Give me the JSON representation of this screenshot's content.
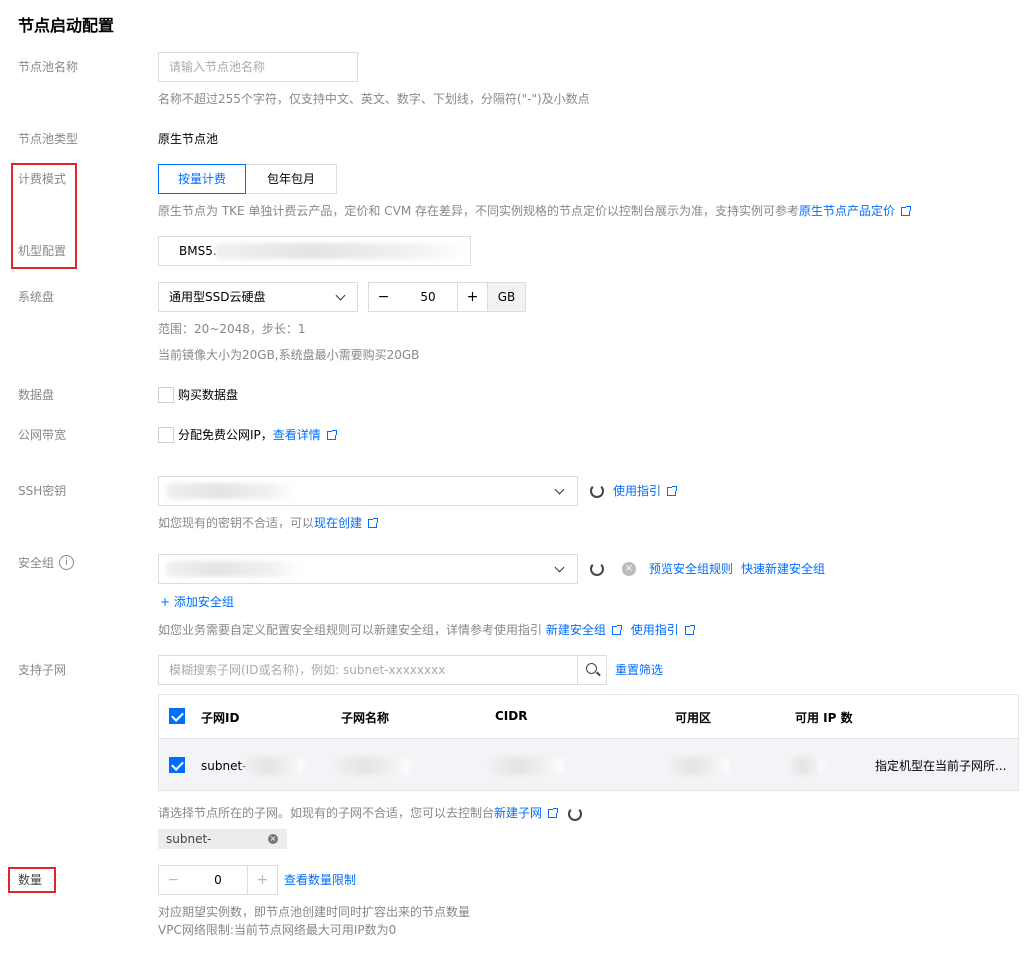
{
  "page": {
    "title": "节点启动配置"
  },
  "colors": {
    "link": "#006eff",
    "highlight": "#e0242b",
    "checkbox": "#006eff"
  },
  "pool_name": {
    "label": "节点池名称",
    "placeholder": "请输入节点池名称",
    "hint": "名称不超过255个字符，仅支持中文、英文、数字、下划线，分隔符(\"-\")及小数点"
  },
  "pool_type": {
    "label": "节点池类型",
    "value": "原生节点池"
  },
  "billing": {
    "label": "计费模式",
    "options": [
      "按量计费",
      "包年包月"
    ],
    "selected": "按量计费",
    "hint": "原生节点为 TKE 单独计费云产品，定价和 CVM 存在差异，不同实例规格的节点定价以控制台展示为准，支持实例可参考",
    "hint_link": "原生节点产品定价"
  },
  "model": {
    "label": "机型配置",
    "value": "BMS5."
  },
  "system_disk": {
    "label": "系统盘",
    "type": "通用型SSD云硬盘",
    "size": "50",
    "unit": "GB",
    "range": "范围：20~2048，步长：1",
    "note": "当前镜像大小为20GB,系统盘最小需要购买20GB",
    "minus_icon": "−",
    "plus_icon": "+"
  },
  "data_disk": {
    "label": "数据盘",
    "checkbox_label": "购买数据盘"
  },
  "bandwidth": {
    "label": "公网带宽",
    "checkbox_label": "分配免费公网IP，",
    "link": "查看详情"
  },
  "ssh": {
    "label": "SSH密钥",
    "guide_link": "使用指引",
    "hint": "如您现有的密钥不合适，可以",
    "create_link": "现在创建"
  },
  "security_group": {
    "label": "安全组",
    "preview_link": "预览安全组规则",
    "quick_create_link": "快速新建安全组",
    "add_link": "添加安全组",
    "add_icon": "+",
    "info_icon": "i",
    "hint": "如您业务需要自定义配置安全组规则可以新建安全组，详情参考使用指引",
    "new_link": "新建安全组",
    "guide_link": "使用指引"
  },
  "subnet": {
    "label": "支持子网",
    "search_placeholder": "模糊搜索子网(ID或名称)，例如: subnet-xxxxxxxx",
    "reset_link": "重置筛选",
    "columns": [
      "子网ID",
      "子网名称",
      "CIDR",
      "可用区",
      "可用 IP 数"
    ],
    "rows": [
      {
        "id": "subnet-",
        "note": "指定机型在当前子网所..."
      }
    ],
    "hint": "请选择节点所在的子网。如现有的子网不合适，您可以去控制台",
    "new_link": "新建子网",
    "selected_tag": "subnet-",
    "tag_close_icon": "×"
  },
  "quantity": {
    "label": "数量",
    "value": "0",
    "limit_link": "查看数量限制",
    "hint1": "对应期望实例数，即节点池创建时同时扩容出来的节点数量",
    "hint2": "VPC网络限制:当前节点网络最大可用IP数为0",
    "minus_icon": "−",
    "plus_icon": "+"
  }
}
